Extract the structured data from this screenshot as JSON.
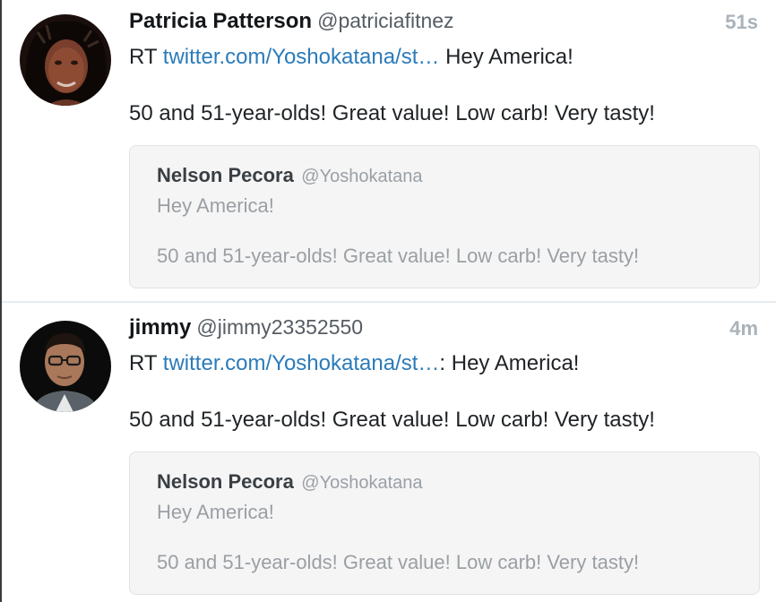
{
  "tweets": [
    {
      "name": "Patricia Patterson",
      "handle": "@patriciafitnez",
      "time": "51s",
      "rt_prefix": "RT ",
      "link": "twitter.com/Yoshokatana/st…",
      "line1_suffix": " Hey America!",
      "line2": "50 and 51-year-olds! Great value! Low carb! Very tasty!",
      "quote": {
        "name": "Nelson Pecora",
        "handle": "@Yoshokatana",
        "line1": "Hey America!",
        "line2": "50 and 51-year-olds! Great value! Low carb! Very tasty!"
      },
      "avatar_icon": "woman-portrait-avatar"
    },
    {
      "name": "jimmy",
      "handle": "@jimmy23352550",
      "time": "4m",
      "rt_prefix": "RT ",
      "link": "twitter.com/Yoshokatana/st…",
      "line1_suffix": ": Hey America!",
      "line2": "50 and 51-year-olds! Great value! Low carb! Very tasty!",
      "quote": {
        "name": "Nelson Pecora",
        "handle": "@Yoshokatana",
        "line1": "Hey America!",
        "line2": "50 and 51-year-olds! Great value! Low carb! Very tasty!"
      },
      "avatar_icon": "man-glasses-portrait-avatar"
    }
  ],
  "colors": {
    "link": "#2b7bb9",
    "quote_bg": "#f5f5f5",
    "time": "#aab2b9"
  }
}
